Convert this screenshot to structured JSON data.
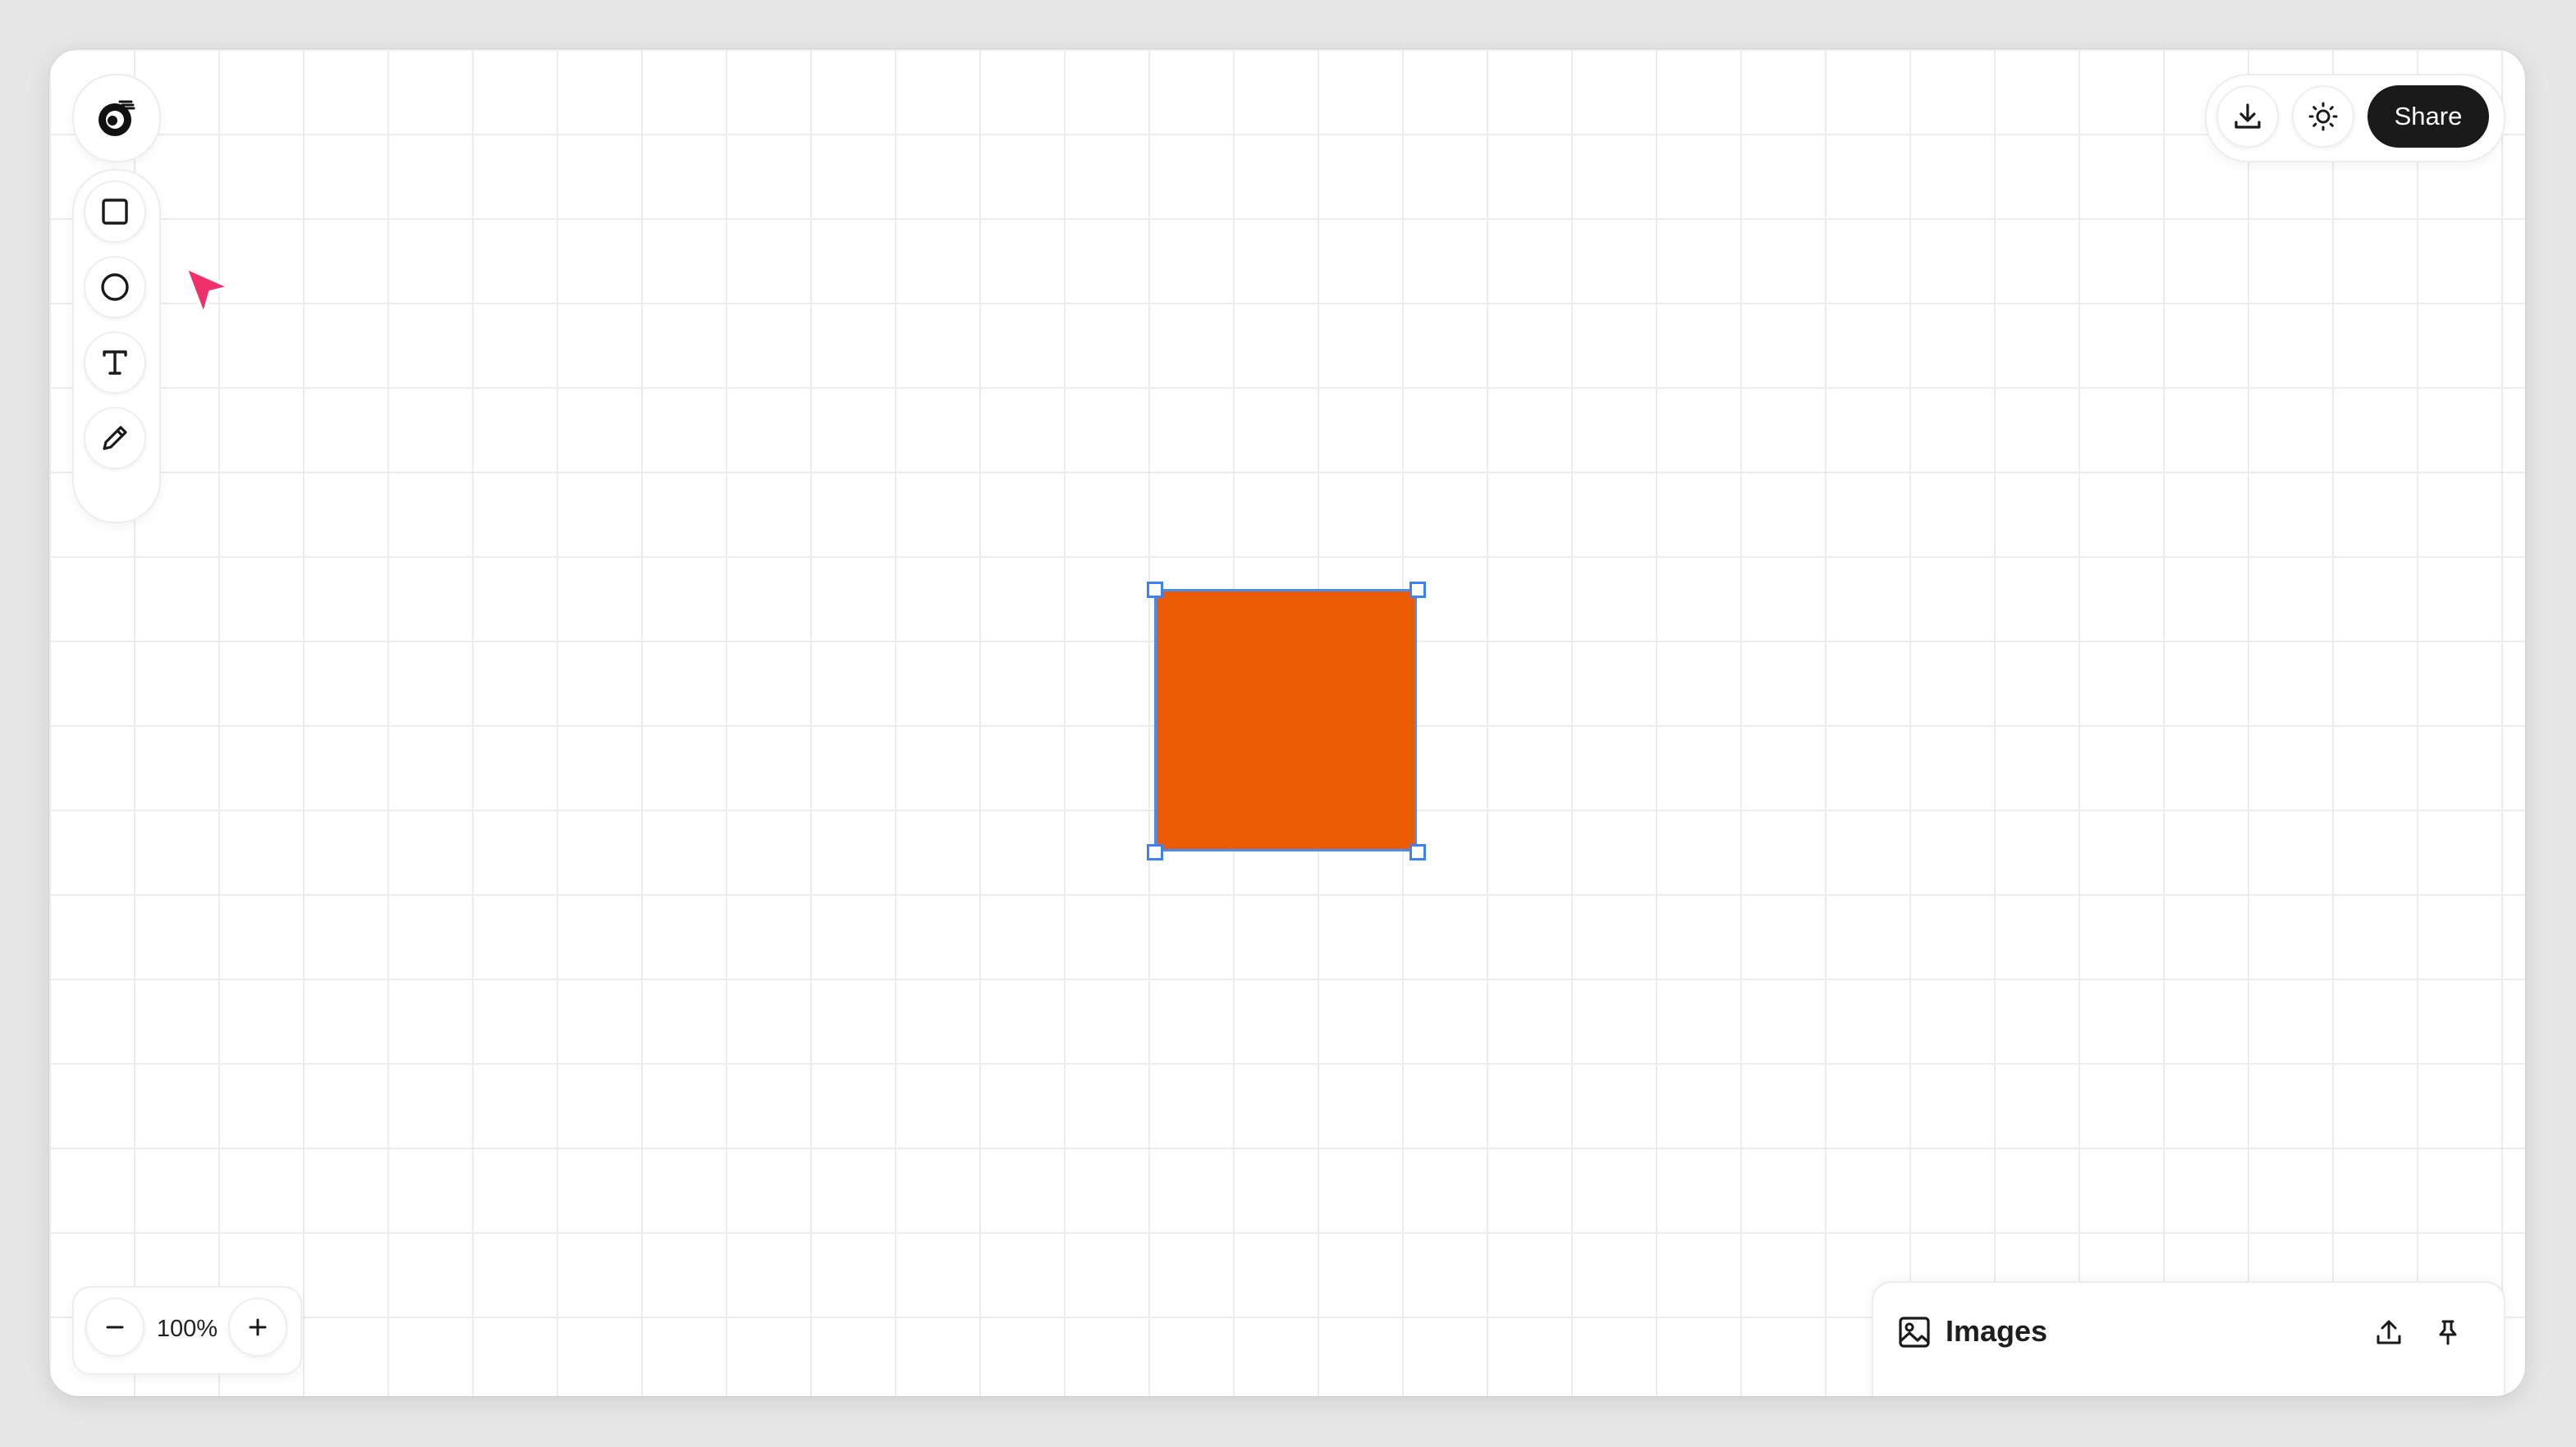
{
  "toolbar_right": {
    "share_label": "Share",
    "download_icon": "download-icon",
    "theme_icon": "sun-icon"
  },
  "tools": [
    {
      "name": "rectangle",
      "icon": "square-icon"
    },
    {
      "name": "ellipse",
      "icon": "circle-icon"
    },
    {
      "name": "text",
      "icon": "text-icon"
    },
    {
      "name": "draw",
      "icon": "pencil-icon"
    }
  ],
  "zoom": {
    "value": "100%",
    "zoom_out_icon": "minus-icon",
    "zoom_in_icon": "plus-icon"
  },
  "images_panel": {
    "title": "Images",
    "upload_icon": "upload-icon",
    "pin_icon": "pin-icon"
  },
  "canvas": {
    "shape_type": "rectangle",
    "shape_fill": "#ea5b04",
    "selection_color": "#3b82f6",
    "selected": true
  },
  "colors": {
    "accent_cursor": "#f0306a",
    "share_bg": "#1a1a1a"
  }
}
